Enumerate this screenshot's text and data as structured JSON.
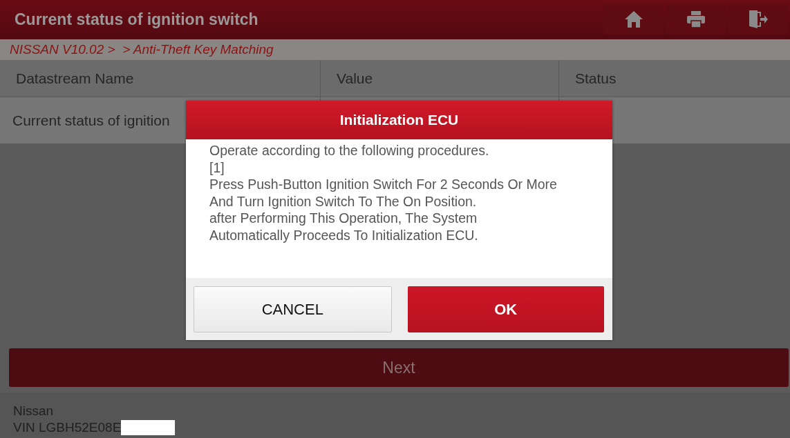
{
  "header": {
    "title": "Current status of ignition switch"
  },
  "breadcrumb": "NISSAN V10.02 >  > Anti-Theft Key Matching",
  "table": {
    "columns": [
      "Datastream Name",
      "Value",
      "Status"
    ],
    "rows": [
      [
        "Current status of ignition",
        "",
        ""
      ]
    ]
  },
  "next_button": "Next",
  "footer": {
    "make": "Nissan",
    "vin": "VIN LGBH52E08E"
  },
  "dialog": {
    "title": "Initialization ECU",
    "lines": [
      "Operate according to the following procedures.",
      "[1]",
      "Press Push-Button Ignition Switch For 2 Seconds Or More",
      "And Turn Ignition Switch To The On Position.",
      "after Performing This Operation, The System",
      "Automatically Proceeds To Initialization ECU."
    ],
    "buttons": [
      {
        "label": "CANCEL",
        "kind": "secondary"
      },
      {
        "label": "OK",
        "kind": "primary"
      }
    ]
  }
}
